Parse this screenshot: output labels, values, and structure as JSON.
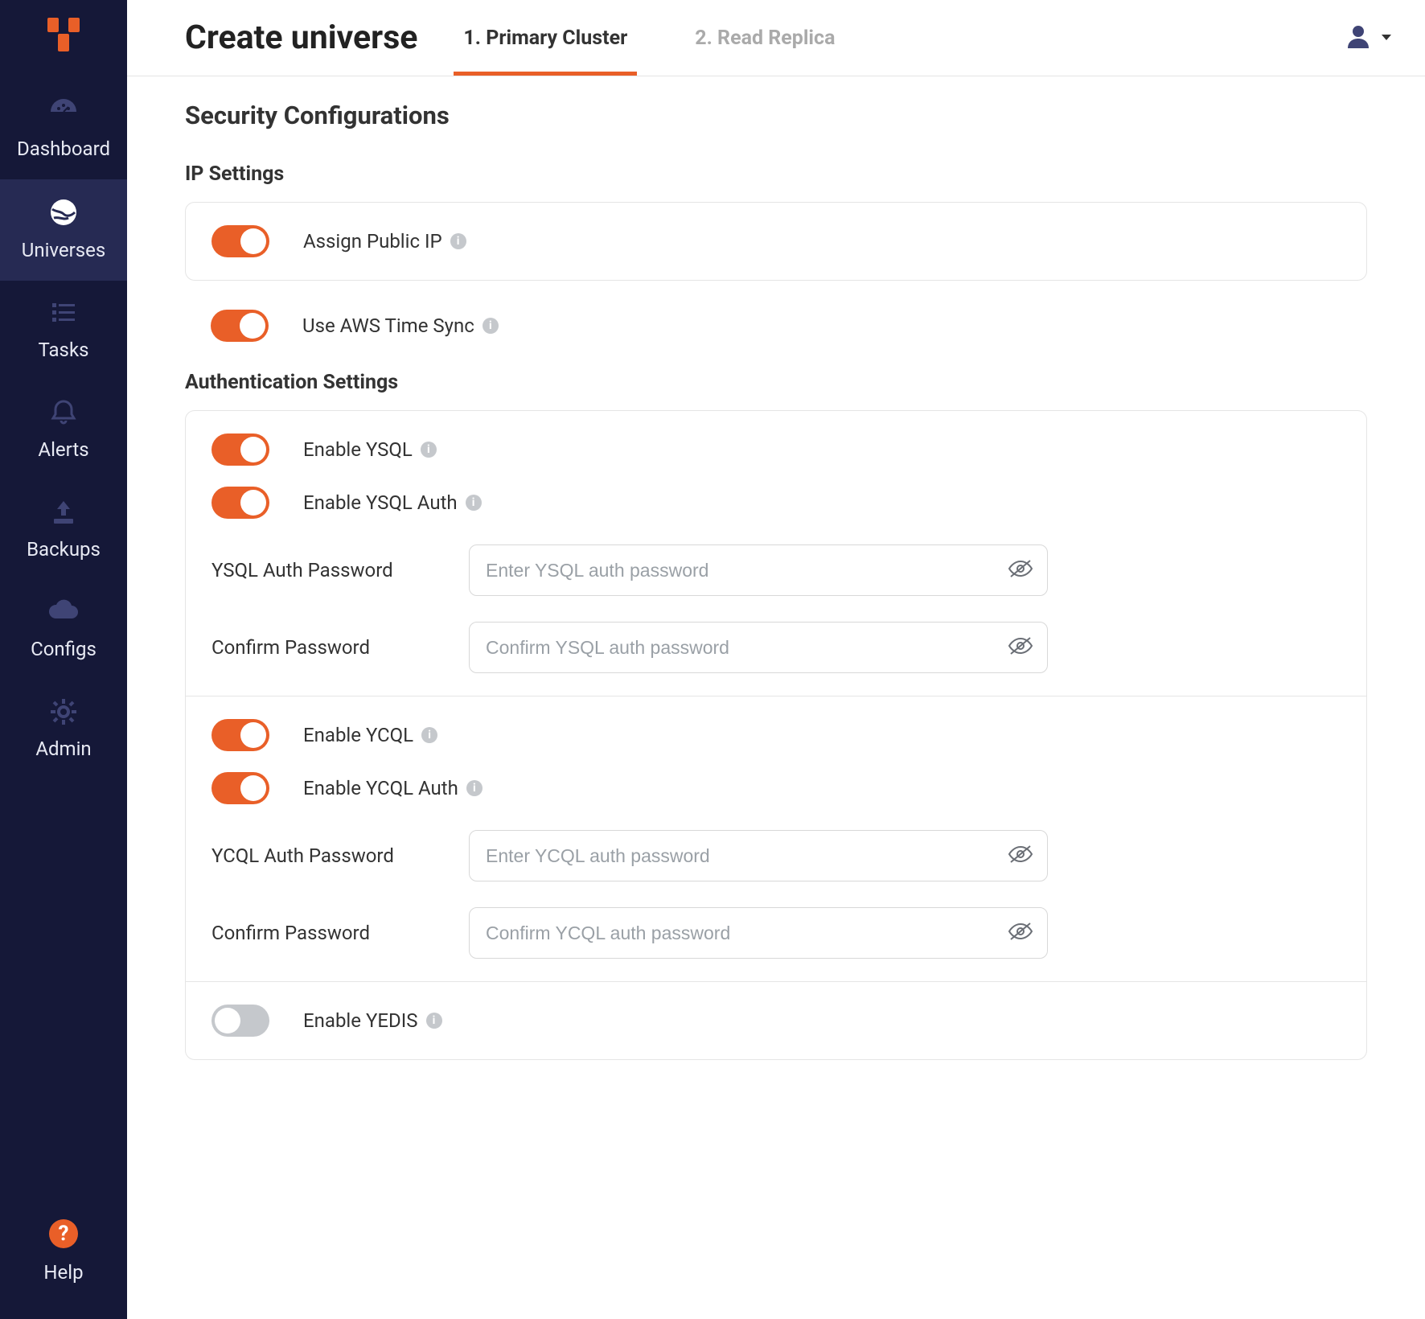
{
  "sidebar": {
    "items": [
      {
        "label": "Dashboard"
      },
      {
        "label": "Universes"
      },
      {
        "label": "Tasks"
      },
      {
        "label": "Alerts"
      },
      {
        "label": "Backups"
      },
      {
        "label": "Configs"
      },
      {
        "label": "Admin"
      }
    ],
    "help_label": "Help"
  },
  "page_title": "Create universe",
  "tabs": {
    "primary": "1. Primary Cluster",
    "replica": "2. Read Replica"
  },
  "section_title": "Security Configurations",
  "ip_settings": {
    "title": "IP Settings",
    "assign_public_ip": "Assign Public IP",
    "use_aws_time_sync": "Use AWS Time Sync"
  },
  "auth_settings": {
    "title": "Authentication Settings",
    "enable_ysql": "Enable YSQL",
    "enable_ysql_auth": "Enable YSQL Auth",
    "ysql_password_label": "YSQL Auth Password",
    "ysql_password_placeholder": "Enter YSQL auth password",
    "ysql_confirm_label": "Confirm Password",
    "ysql_confirm_placeholder": "Confirm YSQL auth password",
    "enable_ycql": "Enable YCQL",
    "enable_ycql_auth": "Enable YCQL Auth",
    "ycql_password_label": "YCQL Auth Password",
    "ycql_password_placeholder": "Enter YCQL auth password",
    "ycql_confirm_label": "Confirm Password",
    "ycql_confirm_placeholder": "Confirm YCQL auth password",
    "enable_yedis": "Enable YEDIS"
  },
  "info_glyph": "i"
}
